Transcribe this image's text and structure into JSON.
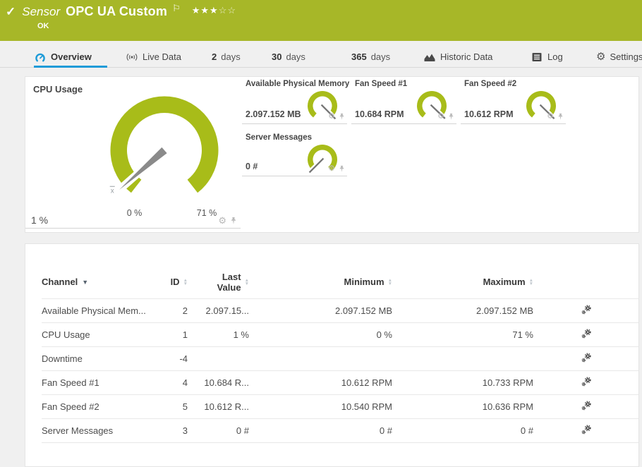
{
  "header": {
    "type_label": "Sensor",
    "title": "OPC UA Custom",
    "status": "OK",
    "stars_filled": 3,
    "stars_total": 5,
    "background_color": "#a7b728"
  },
  "tabs": [
    {
      "label": "Overview",
      "active": true
    },
    {
      "label": "Live Data"
    },
    {
      "num": "2",
      "label": "days"
    },
    {
      "num": "30",
      "label": "days"
    },
    {
      "num": "365",
      "label": "days"
    },
    {
      "label": "Historic Data"
    },
    {
      "label": "Log"
    },
    {
      "label": "Settings"
    }
  ],
  "colors": {
    "gauge_green": "#a8bc19",
    "accent_blue": "#1d9bd8",
    "needle_gray": "#8a8a8a"
  },
  "chart_data": [
    {
      "type": "gauge",
      "title": "CPU Usage",
      "value": 1,
      "min": 0,
      "max": 71,
      "unit": "%",
      "value_label": "1 %",
      "scale_min_label": "0 %",
      "scale_max_label": "71 %",
      "has_average_marker": true
    },
    {
      "type": "gauge",
      "title": "Available Physical Memory",
      "value": 2097152,
      "min": 0,
      "max": 2097152,
      "unit": "MB",
      "value_label": "2.097.152 MB"
    },
    {
      "type": "gauge",
      "title": "Fan Speed #1",
      "value": 10684,
      "min": 0,
      "max": 10733,
      "unit": "RPM",
      "value_label": "10.684 RPM"
    },
    {
      "type": "gauge",
      "title": "Fan Speed #2",
      "value": 10612,
      "min": 0,
      "max": 10636,
      "unit": "RPM",
      "value_label": "10.612 RPM"
    },
    {
      "type": "gauge",
      "title": "Server Messages",
      "value": 0,
      "min": 0,
      "max": 0,
      "unit": "#",
      "value_label": "0 #"
    }
  ],
  "table": {
    "columns": [
      "Channel",
      "ID",
      "Last Value",
      "Minimum",
      "Maximum"
    ],
    "rows": [
      {
        "channel": "Available Physical Mem...",
        "id": "2",
        "last": "2.097.15...",
        "min": "2.097.152 MB",
        "max": "2.097.152 MB"
      },
      {
        "channel": "CPU Usage",
        "id": "1",
        "last": "1 %",
        "min": "0 %",
        "max": "71 %"
      },
      {
        "channel": "Downtime",
        "id": "-4",
        "last": "",
        "min": "",
        "max": ""
      },
      {
        "channel": "Fan Speed #1",
        "id": "4",
        "last": "10.684 R...",
        "min": "10.612 RPM",
        "max": "10.733 RPM"
      },
      {
        "channel": "Fan Speed #2",
        "id": "5",
        "last": "10.612 R...",
        "min": "10.540 RPM",
        "max": "10.636 RPM"
      },
      {
        "channel": "Server Messages",
        "id": "3",
        "last": "0 #",
        "min": "0 #",
        "max": "0 #"
      }
    ]
  }
}
